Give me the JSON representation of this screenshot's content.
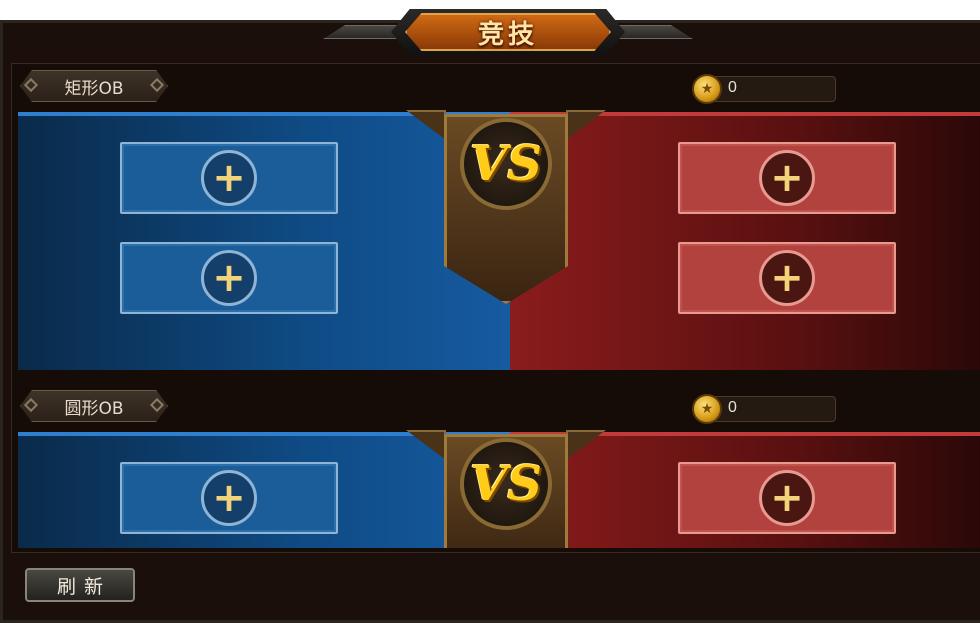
{
  "title": "竞技",
  "sections": [
    {
      "label": "矩形OB",
      "coins": "0",
      "vs_text": "VS",
      "blue_slots": [
        "+",
        "+"
      ],
      "red_slots": [
        "+",
        "+"
      ]
    },
    {
      "label": "圆形OB",
      "coins": "0",
      "vs_text": "VS",
      "blue_slots": [
        "+"
      ],
      "red_slots": [
        "+"
      ]
    }
  ],
  "refresh_label": "刷新",
  "icons": {
    "coin": "coin-icon",
    "slot": "add-plus-icon",
    "vs": "vs-emblem"
  },
  "colors": {
    "blue_team": "#0f4c86",
    "red_team": "#8a1c1c",
    "gold": "#ffcc1a"
  }
}
